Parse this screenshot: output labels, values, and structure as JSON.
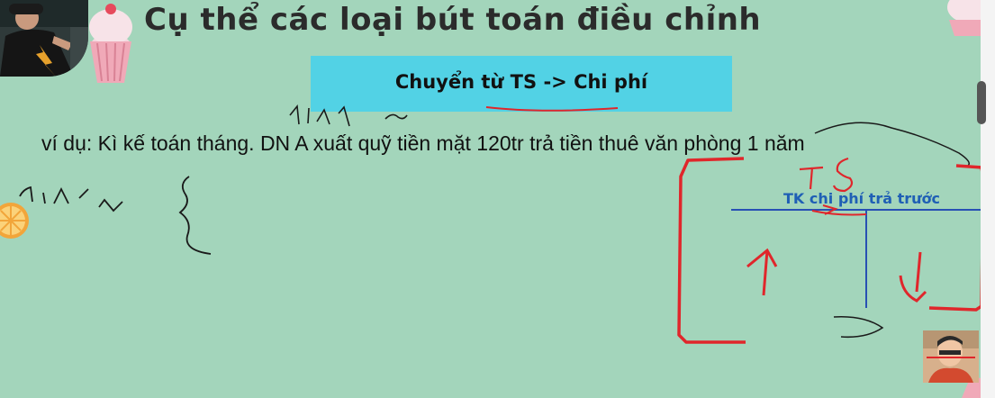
{
  "slide": {
    "title": "Cụ thể các loại bút toán điều chỉnh",
    "banner_label": "Chuyển từ TS -> Chi phí",
    "example_text": "ví dụ: Kì kế toán tháng. DN A xuất quỹ tiền mặt 120tr trả tiền thuê văn phòng 1 năm"
  },
  "t_account": {
    "title": "TK chi phí trả trước"
  },
  "annotations": {
    "ts_label": "TS"
  },
  "colors": {
    "background": "#a3d5bb",
    "banner": "#52d2e5",
    "account_title": "#1f5fb5",
    "ink_red": "#e0262b",
    "ink_black": "#1a1a1a"
  },
  "icons": [
    "cupcake-icon",
    "orange-slice-icon",
    "webcam-presenter",
    "webcam-thumbnail"
  ]
}
